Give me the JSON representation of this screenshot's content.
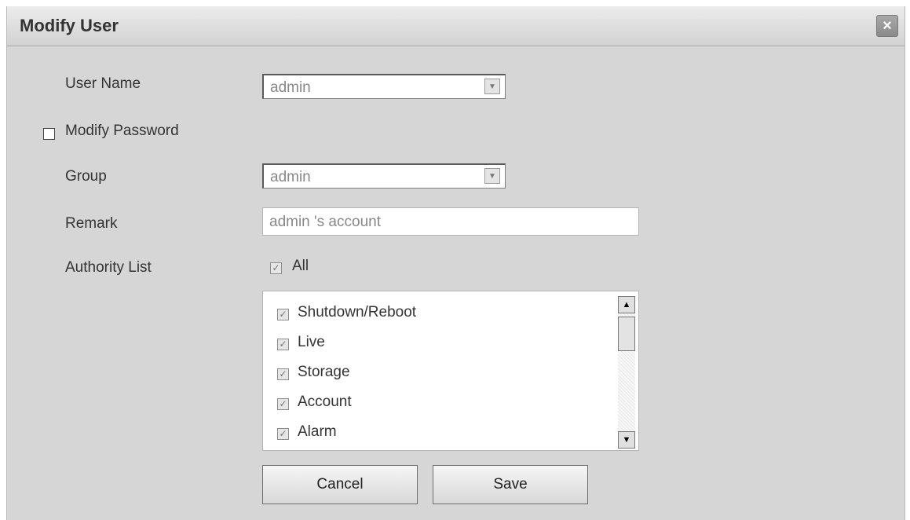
{
  "dialog": {
    "title": "Modify User",
    "close_icon": "×"
  },
  "form": {
    "user_name_label": "User Name",
    "user_name_value": "admin",
    "modify_password_label": "Modify Password",
    "modify_password_checked": false,
    "group_label": "Group",
    "group_value": "admin",
    "remark_label": "Remark",
    "remark_value": "admin 's account",
    "authority_label": "Authority List",
    "all_label": "All",
    "all_checked": true
  },
  "authority_list": {
    "items": [
      {
        "label": "Shutdown/Reboot",
        "checked": true
      },
      {
        "label": "Live",
        "checked": true
      },
      {
        "label": "Storage",
        "checked": true
      },
      {
        "label": "Account",
        "checked": true
      },
      {
        "label": "Alarm",
        "checked": true
      }
    ]
  },
  "buttons": {
    "cancel_label": "Cancel",
    "save_label": "Save"
  },
  "icons": {
    "dropdown_arrow": "▼",
    "scroll_up": "▲",
    "scroll_down": "▼",
    "check": "✓"
  }
}
